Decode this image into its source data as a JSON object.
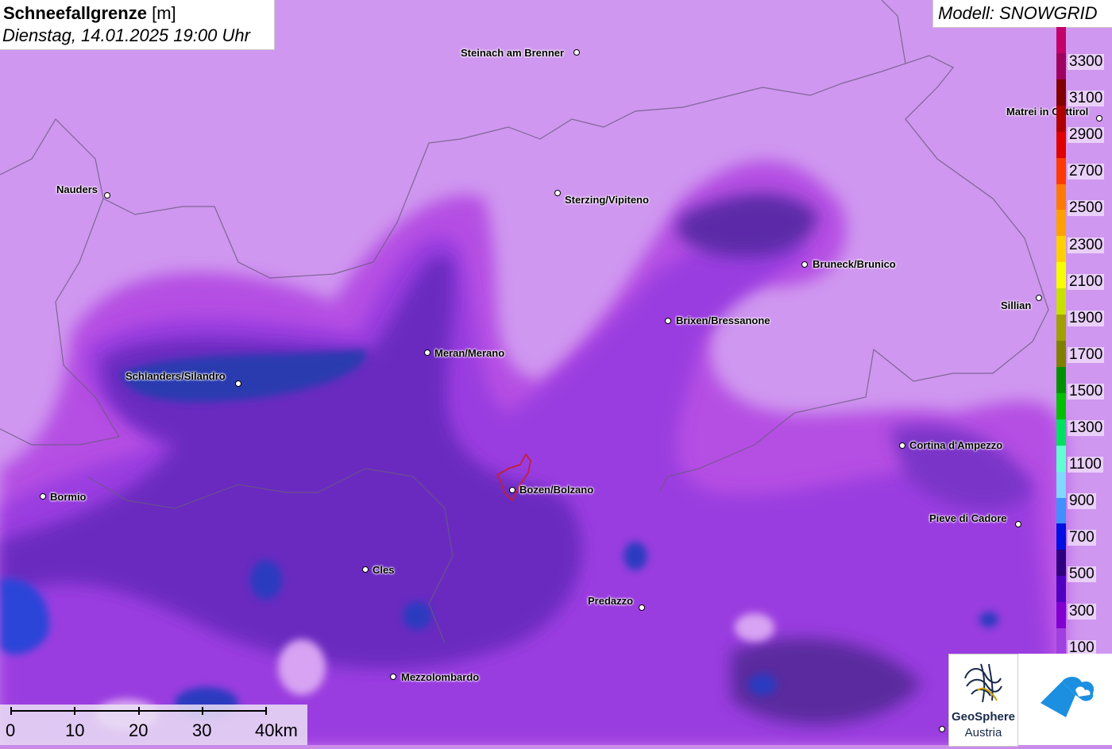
{
  "header": {
    "title_bold": "Schneefallgrenze",
    "title_unit": "[m]",
    "subtitle": "Dienstag, 14.01.2025 19:00 Uhr",
    "model": "Modell: SNOWGRID"
  },
  "legend": {
    "ticks": [
      "3300",
      "3100",
      "2900",
      "2700",
      "2500",
      "2300",
      "2100",
      "1900",
      "1700",
      "1500",
      "1300",
      "1100",
      "900",
      "700",
      "500",
      "300",
      "100"
    ],
    "colors": [
      "#c3006a",
      "#a00060",
      "#800000",
      "#b00000",
      "#e00000",
      "#ff3a00",
      "#ff7a00",
      "#ffa000",
      "#ffd000",
      "#f6ff00",
      "#c8e000",
      "#a0a000",
      "#808000",
      "#009000",
      "#00c000",
      "#00e060",
      "#60ffd0",
      "#80d8ff",
      "#4090ff",
      "#0010e0",
      "#300080",
      "#5000c0",
      "#8000d0",
      "#a040e0"
    ]
  },
  "places": [
    {
      "name": "Steinach am Brenner",
      "side": "left"
    },
    {
      "name": "Nauders",
      "side": "left"
    },
    {
      "name": "Sterzing/Vipiteno",
      "side": "right"
    },
    {
      "name": "Matrei in Osttirol",
      "side": "left"
    },
    {
      "name": "Bruneck/Brunico",
      "side": "right"
    },
    {
      "name": "Sillian",
      "side": "left"
    },
    {
      "name": "Brixen/Bressanone",
      "side": "right"
    },
    {
      "name": "Meran/Merano",
      "side": "right"
    },
    {
      "name": "Schlanders/Silandro",
      "side": "left"
    },
    {
      "name": "Cortina d'Ampezzo",
      "side": "right"
    },
    {
      "name": "Bozen/Bolzano",
      "side": "right"
    },
    {
      "name": "Bormio",
      "side": "right"
    },
    {
      "name": "Pieve di Cadore",
      "side": "left"
    },
    {
      "name": "Cles",
      "side": "right"
    },
    {
      "name": "Predazzo",
      "side": "left"
    },
    {
      "name": "Mezzolombardo",
      "side": "right"
    }
  ],
  "scale": {
    "labels": [
      "0",
      "10",
      "20",
      "30",
      "40km"
    ]
  },
  "logos": {
    "geosphere_line1": "GeoSphere",
    "geosphere_line2": "Austria"
  }
}
